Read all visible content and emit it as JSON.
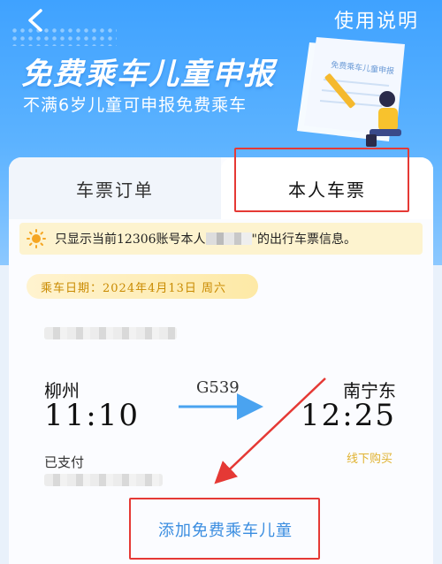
{
  "header": {
    "back_label": "<",
    "help_label": "使用说明",
    "title": "免费乘车儿童申报",
    "subtitle": "不满6岁儿童可申报免费乘车",
    "illustration_text": "免费乘车儿童申报"
  },
  "tabs": [
    {
      "label": "车票订单",
      "active": false
    },
    {
      "label": "本人车票",
      "active": true
    }
  ],
  "notice": {
    "text_before": "只显示当前12306账号本人",
    "text_after": "\"的出行车票信息。"
  },
  "trip": {
    "date_label": "乘车日期：2024年4月13日  周六",
    "from_city": "柳州",
    "from_time": "11:10",
    "train_no": "G539",
    "to_city": "南宁东",
    "to_time": "12:25",
    "payment_status": "已支付",
    "purchase_channel": "线下购买"
  },
  "actions": {
    "add_child_label": "添加免费乘车儿童"
  },
  "colors": {
    "accent_blue": "#3fa2ff",
    "link_blue": "#3a8de0",
    "highlight_red": "#e53935",
    "date_gold": "#c98a00"
  }
}
